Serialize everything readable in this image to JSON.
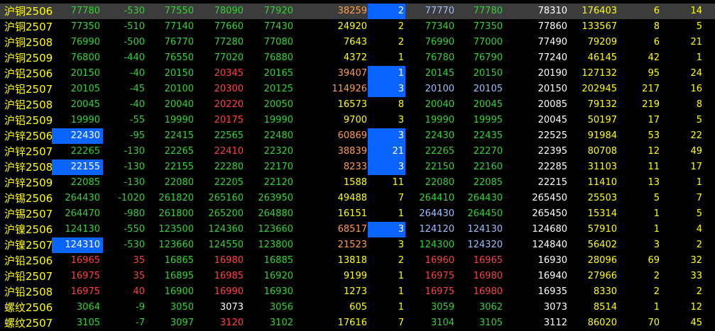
{
  "colors": {
    "up": "#ff4040",
    "down": "#32d232",
    "flat": "#ffffff",
    "name": "#ffff00",
    "volume": "#ffff00",
    "bigVolume": "#ff9c4a",
    "bid": "#9fbeff",
    "highlight": "#0a64ff",
    "selectedRow": "#3c3c3c",
    "background": "#000000"
  },
  "rows": [
    {
      "name": "沪铜2506",
      "last": "77780",
      "chg": "-530",
      "open": "77550",
      "high": "78090",
      "low": "77920",
      "vol": "38259",
      "cur": "2",
      "bid": "77770",
      "ask": "77780",
      "prev": "78310",
      "oi": "176403",
      "d1": "6",
      "d2": "14",
      "c": {
        "last": "down",
        "chg": "down",
        "open": "down",
        "high": "down",
        "low": "down",
        "vol": "orange",
        "bid": "blue",
        "ask": "down",
        "cur": "white"
      },
      "hl": {
        "cur": true
      },
      "selected": true
    },
    {
      "name": "沪铜2507",
      "last": "77350",
      "chg": "-510",
      "open": "77140",
      "high": "77660",
      "low": "77430",
      "vol": "24920",
      "cur": "2",
      "bid": "77340",
      "ask": "77350",
      "prev": "77860",
      "oi": "133567",
      "d1": "8",
      "d2": "5",
      "c": {
        "last": "down",
        "chg": "down",
        "open": "down",
        "high": "down",
        "low": "down",
        "bid": "down",
        "ask": "down"
      },
      "hl": {}
    },
    {
      "name": "沪铜2508",
      "last": "76990",
      "chg": "-500",
      "open": "76770",
      "high": "77280",
      "low": "77080",
      "vol": "7643",
      "cur": "2",
      "bid": "76990",
      "ask": "77000",
      "prev": "77490",
      "oi": "79209",
      "d1": "6",
      "d2": "21",
      "c": {
        "last": "down",
        "chg": "down",
        "open": "down",
        "high": "down",
        "low": "down",
        "bid": "down",
        "ask": "down"
      },
      "hl": {}
    },
    {
      "name": "沪铜2509",
      "last": "76800",
      "chg": "-440",
      "open": "76550",
      "high": "77020",
      "low": "76880",
      "vol": "4372",
      "cur": "1",
      "bid": "76780",
      "ask": "76790",
      "prev": "77240",
      "oi": "46145",
      "d1": "42",
      "d2": "1",
      "c": {
        "last": "down",
        "chg": "down",
        "open": "down",
        "high": "down",
        "low": "down",
        "bid": "down",
        "ask": "down"
      },
      "hl": {}
    },
    {
      "name": "沪铝2506",
      "last": "20150",
      "chg": "-40",
      "open": "20150",
      "high": "20345",
      "low": "20165",
      "vol": "39407",
      "cur": "1",
      "bid": "20145",
      "ask": "20150",
      "prev": "20190",
      "oi": "127132",
      "d1": "95",
      "d2": "24",
      "c": {
        "last": "down",
        "chg": "down",
        "open": "down",
        "high": "up",
        "low": "down",
        "vol": "orange",
        "bid": "down",
        "ask": "down"
      },
      "hl": {
        "cur": true
      }
    },
    {
      "name": "沪铝2507",
      "last": "20105",
      "chg": "-45",
      "open": "20100",
      "high": "20300",
      "low": "20125",
      "vol": "114926",
      "cur": "3",
      "bid": "20100",
      "ask": "20105",
      "prev": "20150",
      "oi": "202945",
      "d1": "217",
      "d2": "16",
      "c": {
        "last": "down",
        "chg": "down",
        "open": "down",
        "high": "up",
        "low": "down",
        "vol": "orange",
        "bid": "blue",
        "ask": "blue"
      },
      "hl": {
        "cur": true
      }
    },
    {
      "name": "沪铝2508",
      "last": "20045",
      "chg": "-40",
      "open": "20040",
      "high": "20220",
      "low": "20050",
      "vol": "16573",
      "cur": "8",
      "bid": "20040",
      "ask": "20045",
      "prev": "20085",
      "oi": "79132",
      "d1": "219",
      "d2": "8",
      "c": {
        "last": "down",
        "chg": "down",
        "open": "down",
        "high": "up",
        "low": "down",
        "bid": "down",
        "ask": "down"
      },
      "hl": {}
    },
    {
      "name": "沪铝2509",
      "last": "19990",
      "chg": "-55",
      "open": "19990",
      "high": "20175",
      "low": "19990",
      "vol": "9700",
      "cur": "3",
      "bid": "19990",
      "ask": "19995",
      "prev": "20045",
      "oi": "50197",
      "d1": "17",
      "d2": "5",
      "c": {
        "last": "down",
        "chg": "down",
        "open": "down",
        "high": "up",
        "low": "down",
        "bid": "down",
        "ask": "down"
      },
      "hl": {}
    },
    {
      "name": "沪锌2506",
      "last": "22430",
      "chg": "-95",
      "open": "22415",
      "high": "22565",
      "low": "22480",
      "vol": "60869",
      "cur": "3",
      "bid": "22430",
      "ask": "22435",
      "prev": "22525",
      "oi": "91984",
      "d1": "53",
      "d2": "22",
      "c": {
        "last": "white",
        "chg": "down",
        "open": "down",
        "high": "down",
        "low": "down",
        "vol": "orange",
        "bid": "down",
        "ask": "down"
      },
      "hl": {
        "last": true,
        "cur": true
      }
    },
    {
      "name": "沪锌2507",
      "last": "22265",
      "chg": "-130",
      "open": "22265",
      "high": "22410",
      "low": "22320",
      "vol": "38839",
      "cur": "21",
      "bid": "22265",
      "ask": "22270",
      "prev": "22395",
      "oi": "80708",
      "d1": "12",
      "d2": "49",
      "c": {
        "last": "down",
        "chg": "down",
        "open": "down",
        "high": "up",
        "low": "down",
        "vol": "orange",
        "bid": "down",
        "ask": "down"
      },
      "hl": {
        "cur": true
      }
    },
    {
      "name": "沪锌2508",
      "last": "22155",
      "chg": "-130",
      "open": "22155",
      "high": "22280",
      "low": "22170",
      "vol": "8233",
      "cur": "3",
      "bid": "22150",
      "ask": "22160",
      "prev": "22285",
      "oi": "31103",
      "d1": "11",
      "d2": "17",
      "c": {
        "last": "white",
        "chg": "down",
        "open": "down",
        "high": "down",
        "low": "down",
        "vol": "orange",
        "bid": "down",
        "ask": "down"
      },
      "hl": {
        "last": true,
        "cur": true
      }
    },
    {
      "name": "沪锌2509",
      "last": "22085",
      "chg": "-130",
      "open": "22080",
      "high": "22205",
      "low": "22120",
      "vol": "1588",
      "cur": "11",
      "bid": "22080",
      "ask": "22085",
      "prev": "22215",
      "oi": "11410",
      "d1": "13",
      "d2": "1",
      "c": {
        "last": "down",
        "chg": "down",
        "open": "down",
        "high": "down",
        "low": "down",
        "bid": "down",
        "ask": "down"
      },
      "hl": {}
    },
    {
      "name": "沪锡2506",
      "last": "264430",
      "chg": "-1020",
      "open": "261820",
      "high": "265160",
      "low": "263950",
      "vol": "49488",
      "cur": "7",
      "bid": "264410",
      "ask": "264430",
      "prev": "265450",
      "oi": "25503",
      "d1": "5",
      "d2": "7",
      "c": {
        "last": "down",
        "chg": "down",
        "open": "down",
        "high": "down",
        "low": "down",
        "bid": "down",
        "ask": "down"
      },
      "hl": {}
    },
    {
      "name": "沪锡2507",
      "last": "264470",
      "chg": "-980",
      "open": "261800",
      "high": "265200",
      "low": "264880",
      "vol": "16151",
      "cur": "1",
      "bid": "264430",
      "ask": "264450",
      "prev": "265450",
      "oi": "15314",
      "d1": "1",
      "d2": "5",
      "c": {
        "last": "down",
        "chg": "down",
        "open": "down",
        "high": "down",
        "low": "down",
        "bid": "blue",
        "ask": "down"
      },
      "hl": {}
    },
    {
      "name": "沪镍2506",
      "last": "124130",
      "chg": "-550",
      "open": "123500",
      "high": "124360",
      "low": "123660",
      "vol": "68517",
      "cur": "3",
      "bid": "124120",
      "ask": "124130",
      "prev": "124680",
      "oi": "57910",
      "d1": "1",
      "d2": "4",
      "c": {
        "last": "down",
        "chg": "down",
        "open": "down",
        "high": "down",
        "low": "down",
        "vol": "orange",
        "bid": "blue",
        "ask": "blue"
      },
      "hl": {
        "cur": true
      }
    },
    {
      "name": "沪镍2507",
      "last": "124310",
      "chg": "-530",
      "open": "123660",
      "high": "124550",
      "low": "123800",
      "vol": "21523",
      "cur": "3",
      "bid": "124300",
      "ask": "124320",
      "prev": "124840",
      "oi": "56402",
      "d1": "3",
      "d2": "2",
      "c": {
        "last": "white",
        "chg": "down",
        "open": "down",
        "high": "down",
        "low": "down",
        "vol": "orange",
        "bid": "down",
        "ask": "blue"
      },
      "hl": {
        "last": true
      }
    },
    {
      "name": "沪铅2506",
      "last": "16965",
      "chg": "35",
      "open": "16865",
      "high": "16980",
      "low": "16885",
      "vol": "13818",
      "cur": "2",
      "bid": "16960",
      "ask": "16965",
      "prev": "16930",
      "oi": "28096",
      "d1": "69",
      "d2": "32",
      "c": {
        "last": "up",
        "chg": "up",
        "open": "down",
        "high": "up",
        "low": "down",
        "bid": "up",
        "ask": "up"
      },
      "hl": {}
    },
    {
      "name": "沪铅2507",
      "last": "16975",
      "chg": "35",
      "open": "16895",
      "high": "16985",
      "low": "16920",
      "vol": "9199",
      "cur": "1",
      "bid": "16975",
      "ask": "16980",
      "prev": "16940",
      "oi": "27966",
      "d1": "2",
      "d2": "33",
      "c": {
        "last": "up",
        "chg": "up",
        "open": "down",
        "high": "up",
        "low": "down",
        "bid": "up",
        "ask": "up"
      },
      "hl": {}
    },
    {
      "name": "沪铅2508",
      "last": "16975",
      "chg": "40",
      "open": "16900",
      "high": "16990",
      "low": "16930",
      "vol": "1273",
      "cur": "1",
      "bid": "16975",
      "ask": "16980",
      "prev": "16935",
      "oi": "8330",
      "d1": "2",
      "d2": "2",
      "c": {
        "last": "up",
        "chg": "up",
        "open": "down",
        "high": "up",
        "low": "down",
        "bid": "up",
        "ask": "up"
      },
      "hl": {}
    },
    {
      "name": "螺纹2506",
      "last": "3064",
      "chg": "-9",
      "open": "3050",
      "high": "3073",
      "low": "3056",
      "vol": "605",
      "cur": "1",
      "bid": "3059",
      "ask": "3062",
      "prev": "3073",
      "oi": "8514",
      "d1": "1",
      "d2": "12",
      "c": {
        "last": "down",
        "chg": "down",
        "open": "down",
        "high": "flat",
        "low": "down",
        "bid": "down",
        "ask": "down"
      },
      "hl": {}
    },
    {
      "name": "螺纹2507",
      "last": "3105",
      "chg": "-7",
      "open": "3097",
      "high": "3120",
      "low": "3102",
      "vol": "17616",
      "cur": "7",
      "bid": "3104",
      "ask": "3105",
      "prev": "3112",
      "oi": "86020",
      "d1": "70",
      "d2": "45",
      "c": {
        "last": "down",
        "chg": "down",
        "open": "down",
        "high": "up",
        "low": "down",
        "bid": "down",
        "ask": "down"
      },
      "hl": {}
    }
  ]
}
